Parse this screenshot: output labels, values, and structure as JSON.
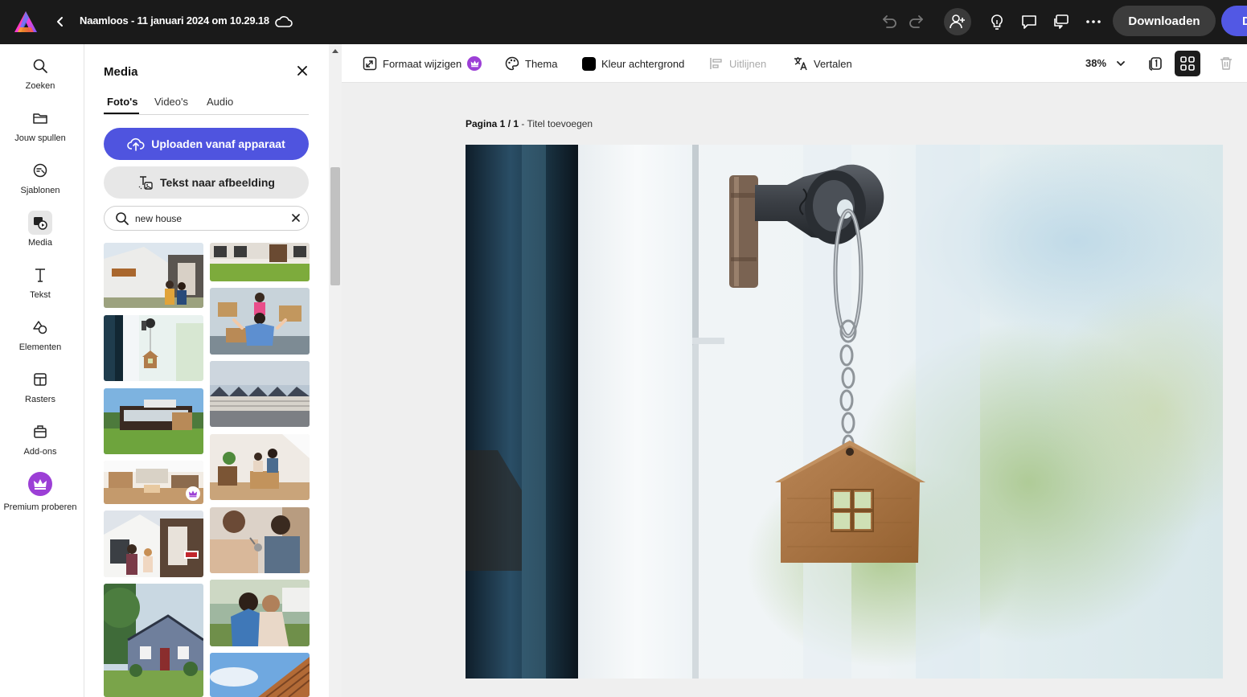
{
  "header": {
    "doc_title": "Naamloos - 11 januari 2024 om 10.29.18",
    "download_label": "Downloaden",
    "share_label": "D"
  },
  "rail": {
    "items": [
      {
        "label": "Zoeken",
        "icon": "search-icon"
      },
      {
        "label": "Jouw spullen",
        "icon": "folder-icon"
      },
      {
        "label": "Sjablonen",
        "icon": "templates-icon"
      },
      {
        "label": "Media",
        "icon": "media-icon",
        "active": true
      },
      {
        "label": "Tekst",
        "icon": "text-icon"
      },
      {
        "label": "Elementen",
        "icon": "elements-icon"
      },
      {
        "label": "Rasters",
        "icon": "grids-icon"
      },
      {
        "label": "Add-ons",
        "icon": "addons-icon"
      },
      {
        "label": "Premium proberen",
        "icon": "crown-icon"
      }
    ]
  },
  "panel": {
    "title": "Media",
    "tabs": [
      {
        "label": "Foto's",
        "active": true
      },
      {
        "label": "Video's"
      },
      {
        "label": "Audio"
      }
    ],
    "upload_label": "Uploaden vanaf apparaat",
    "text_to_image_label": "Tekst naar afbeelding",
    "search_value": "new house"
  },
  "toolbar": {
    "resize_label": "Formaat wijzigen",
    "theme_label": "Thema",
    "background_label": "Kleur achtergrond",
    "align_label": "Uitlijnen",
    "translate_label": "Vertalen",
    "zoom": "38%"
  },
  "canvas": {
    "page_number": "Pagina 1 / 1",
    "page_title": "Titel toevoegen"
  },
  "colors": {
    "topbar": "#1a1a1a",
    "accent": "#4f54df",
    "premium": "#9c3fd6"
  }
}
